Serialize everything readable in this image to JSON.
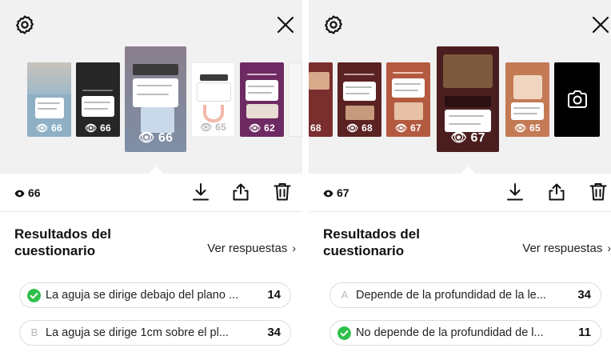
{
  "left": {
    "thumbnails": [
      {
        "views": "66",
        "bg": "#8aa6b8"
      },
      {
        "views": "66",
        "bg": "#2c2c2c"
      },
      {
        "views": "66",
        "bg": "#7f7a86"
      },
      {
        "views": "65",
        "bg": "#ffffff"
      },
      {
        "views": "62",
        "bg": "#6a2a5e"
      }
    ],
    "view_count": "66",
    "results_title": "Resultados del cuestionario",
    "see_answers": "Ver respuestas",
    "options": [
      {
        "letter": "",
        "correct": true,
        "text": "La aguja se dirige debajo del plano ...",
        "count": "14"
      },
      {
        "letter": "B",
        "correct": false,
        "text": "La aguja se dirige  1cm  sobre el pl...",
        "count": "34"
      }
    ]
  },
  "right": {
    "thumbnails": [
      {
        "views": "68",
        "bg": "#7a2e2e"
      },
      {
        "views": "68",
        "bg": "#5a2222"
      },
      {
        "views": "67",
        "bg": "#b0503a"
      },
      {
        "views": "67",
        "bg": "#4a1e1e"
      },
      {
        "views": "65",
        "bg": "#c37a55"
      }
    ],
    "view_count": "67",
    "results_title": "Resultados del cuestionario",
    "see_answers": "Ver respuestas",
    "options": [
      {
        "letter": "A",
        "correct": false,
        "text": "Depende de la profundidad de la le...",
        "count": "34"
      },
      {
        "letter": "",
        "correct": true,
        "text": "No depende de la profundidad de l...",
        "count": "11"
      }
    ]
  },
  "colors": {
    "correct": "#2fbf4a",
    "camera_tile": "#000000"
  }
}
